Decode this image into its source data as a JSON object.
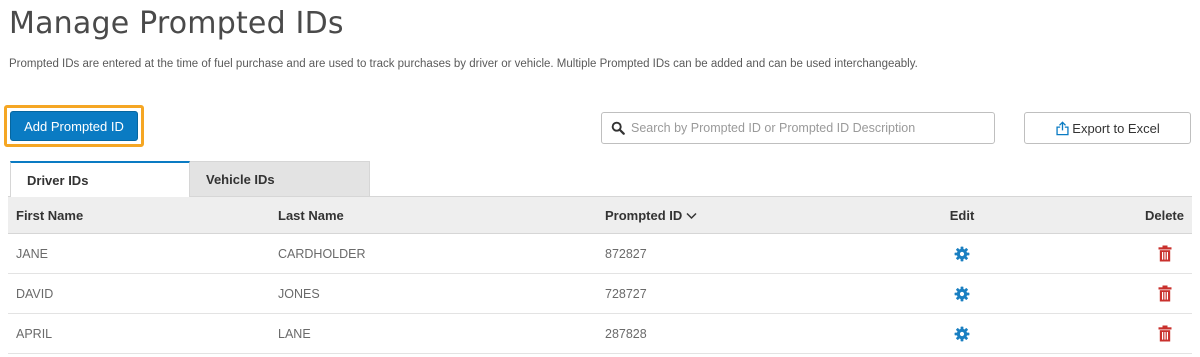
{
  "page": {
    "title": "Manage Prompted IDs",
    "description": "Prompted IDs are entered at the time of fuel purchase and are used to track purchases by driver or vehicle.  Multiple Prompted IDs can be added and can be used interchangeably."
  },
  "toolbar": {
    "add_label": "Add Prompted ID",
    "search_placeholder": "Search by Prompted ID or Prompted ID Description",
    "search_value": "",
    "export_label": "Export to Excel"
  },
  "tabs": [
    {
      "label": "Driver IDs",
      "active": true
    },
    {
      "label": "Vehicle IDs",
      "active": false
    }
  ],
  "table": {
    "columns": [
      "First Name",
      "Last Name",
      "Prompted ID",
      "Edit",
      "Delete"
    ],
    "sort_column": "Prompted ID",
    "sort_direction": "descending",
    "rows": [
      {
        "first_name": "JANE",
        "last_name": "CARDHOLDER",
        "prompted_id": "872827"
      },
      {
        "first_name": "DAVID",
        "last_name": "JONES",
        "prompted_id": "728727"
      },
      {
        "first_name": "APRIL",
        "last_name": "LANE",
        "prompted_id": "287828"
      }
    ]
  },
  "icons": {
    "search": "search-icon",
    "export": "export-icon",
    "sort": "chevron-down-icon",
    "edit": "gear-icon",
    "delete": "trash-icon"
  },
  "colors": {
    "primary": "#0a7bc3",
    "highlight_outline": "#f5a623",
    "delete": "#c9302c",
    "edit": "#1a7fc1"
  }
}
